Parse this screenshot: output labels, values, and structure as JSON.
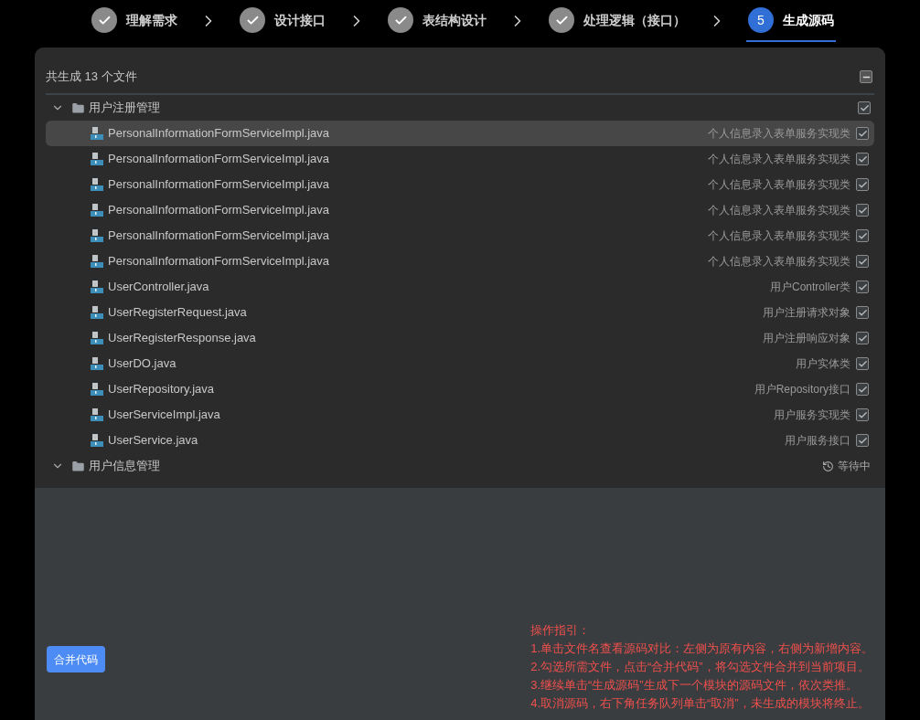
{
  "steps": [
    {
      "label": "理解需求",
      "done": true,
      "selected": false
    },
    {
      "label": "设计接口",
      "done": true,
      "selected": false
    },
    {
      "label": "表结构设计",
      "done": true,
      "selected": false
    },
    {
      "label": "处理逻辑（接口）",
      "done": true,
      "selected": false
    },
    {
      "label": "生成源码",
      "number": "5",
      "done": false,
      "selected": true
    }
  ],
  "summary": "共生成 13 个文件",
  "groups": [
    {
      "name": "用户注册管理",
      "expanded": true,
      "checked": true,
      "files": [
        {
          "name": "PersonalInformationFormServiceImpl.java",
          "desc": "个人信息录入表单服务实现类",
          "checked": true,
          "selected": true
        },
        {
          "name": "PersonalInformationFormServiceImpl.java",
          "desc": "个人信息录入表单服务实现类",
          "checked": true,
          "selected": false
        },
        {
          "name": "PersonalInformationFormServiceImpl.java",
          "desc": "个人信息录入表单服务实现类",
          "checked": true,
          "selected": false
        },
        {
          "name": "PersonalInformationFormServiceImpl.java",
          "desc": "个人信息录入表单服务实现类",
          "checked": true,
          "selected": false
        },
        {
          "name": "PersonalInformationFormServiceImpl.java",
          "desc": "个人信息录入表单服务实现类",
          "checked": true,
          "selected": false
        },
        {
          "name": "PersonalInformationFormServiceImpl.java",
          "desc": "个人信息录入表单服务实现类",
          "checked": true,
          "selected": false
        },
        {
          "name": "UserController.java",
          "desc": "用户Controller类",
          "checked": true,
          "selected": false
        },
        {
          "name": "UserRegisterRequest.java",
          "desc": "用户注册请求对象",
          "checked": true,
          "selected": false
        },
        {
          "name": "UserRegisterResponse.java",
          "desc": "用户注册响应对象",
          "checked": true,
          "selected": false
        },
        {
          "name": "UserDO.java",
          "desc": "用户实体类",
          "checked": true,
          "selected": false
        },
        {
          "name": "UserRepository.java",
          "desc": "用户Repository接口",
          "checked": true,
          "selected": false
        },
        {
          "name": "UserServiceImpl.java",
          "desc": "用户服务实现类",
          "checked": true,
          "selected": false
        },
        {
          "name": "UserService.java",
          "desc": "用户服务接口",
          "checked": true,
          "selected": false
        }
      ]
    },
    {
      "name": "用户信息管理",
      "expanded": true,
      "status": "等待中"
    }
  ],
  "merge_button": "合并代码",
  "guide": {
    "title": "操作指引：",
    "lines": [
      "1.单击文件名查看源码对比：左侧为原有内容，右侧为新增内容。",
      "2.勾选所需文件，点击“合并代码”，将勾选文件合并到当前项目。",
      "3.继续单击“生成源码”生成下一个模块的源码文件，依次类推。",
      "4.取消源码，右下角任务队列单击“取消”，未生成的模块将终止。"
    ]
  }
}
